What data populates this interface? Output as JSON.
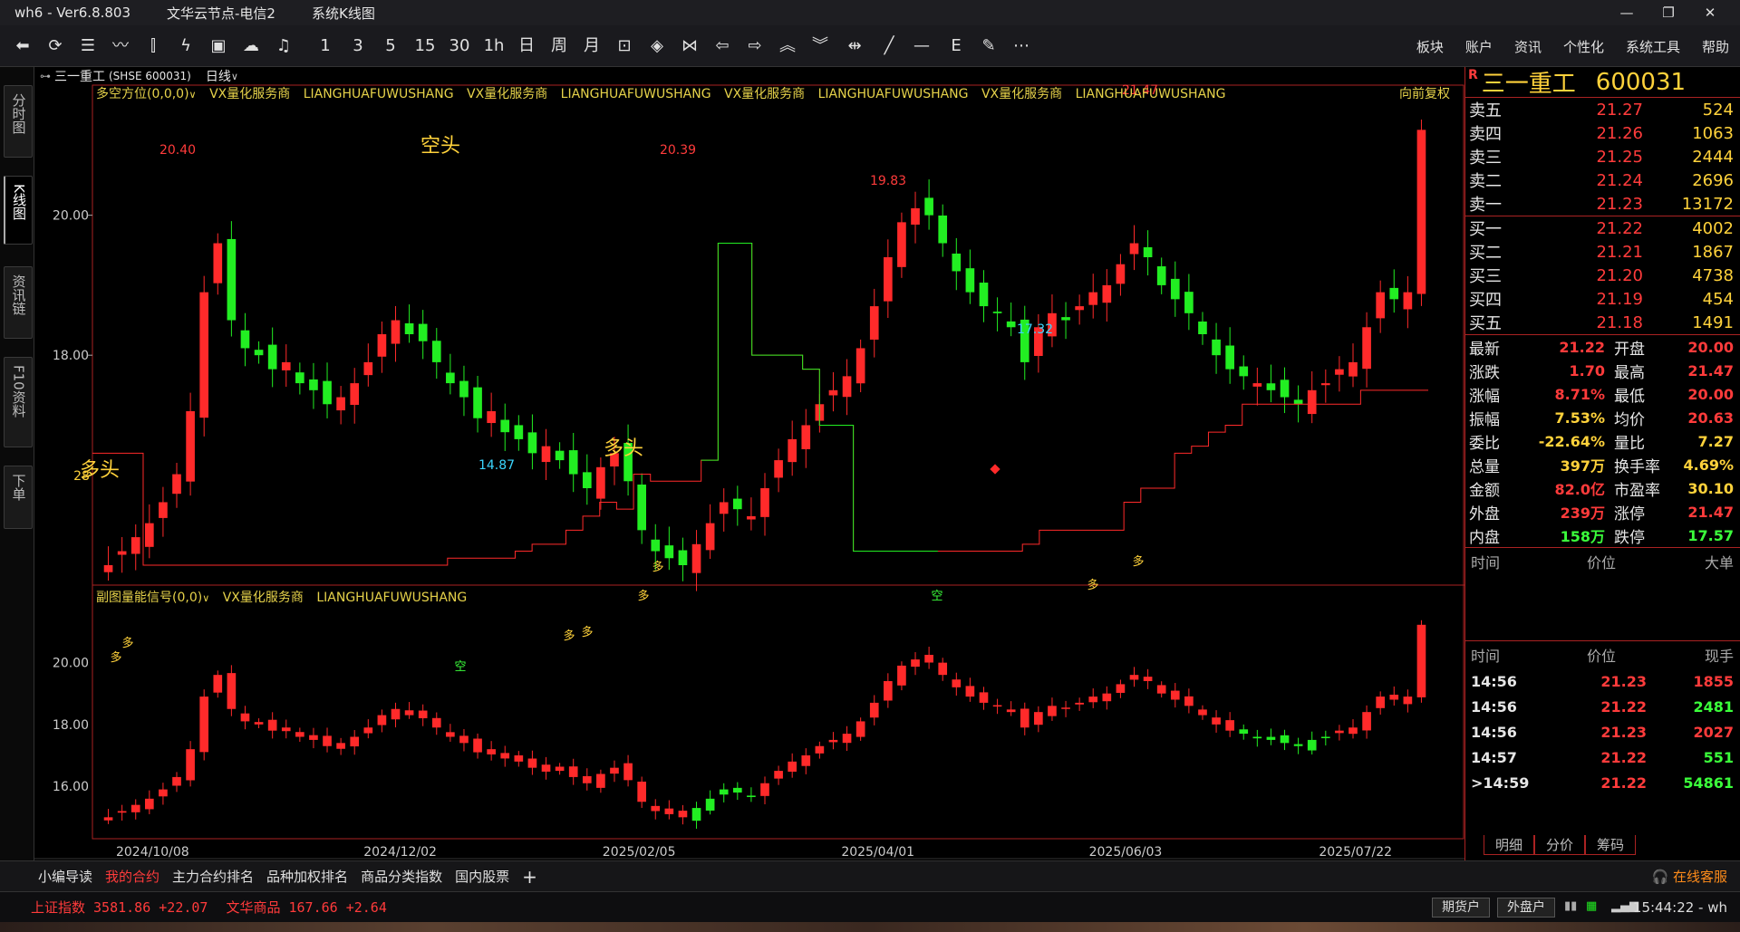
{
  "window": {
    "app": "wh6 - Ver6.8.803",
    "node": "文华云节点-电信2",
    "view": "系统K线图",
    "controls": [
      "—",
      "❐",
      "✕"
    ]
  },
  "toolbar": {
    "icons": [
      "back-icon",
      "refresh-icon",
      "table-icon",
      "line-chart-icon",
      "candle-icon",
      "lightning-icon",
      "grid-icon",
      "cloud-sync-icon",
      "bell-icon"
    ],
    "periods": [
      "1",
      "3",
      "5",
      "15",
      "30",
      "1h",
      "日",
      "周",
      "月"
    ],
    "menus": [
      "板块",
      "账户",
      "资讯",
      "个性化",
      "系统工具",
      "帮助"
    ]
  },
  "left_tabs": [
    "分时图",
    "K线图",
    "资讯链",
    "F10资料",
    "下单"
  ],
  "chart": {
    "symbol_name": "三一重工",
    "symbol_code": "(SHSE 600031)",
    "cycle": "日线",
    "indicator_main": "多空方位(0,0,0)",
    "indicator_sub": "副图量能信号(0,0)",
    "promo": "VX量化服务商",
    "promo_py": "LIANGHUAFUWUSHANG",
    "restore": "向前复权",
    "y_main": [
      "20.00",
      "18.00"
    ],
    "y_sub": [
      "20.00",
      "18.00",
      "16.00"
    ],
    "x_labels": [
      "2024/10/08",
      "2024/12/02",
      "2025/02/05",
      "2025/04/01",
      "2025/06/03",
      "2025/07/22"
    ],
    "labels": {
      "high1": "20.40",
      "high2": "20.39",
      "high3": "19.83",
      "high4": "21.47",
      "low1": "14.87",
      "low2": "17.32",
      "corner": "28"
    },
    "annotations": {
      "bear": "空头",
      "bull": "多头",
      "bull_left": "多头",
      "sig_bull": "多",
      "sig_bear": "空"
    }
  },
  "chart_data": {
    "type": "candlestick",
    "title": "",
    "xlabel": "",
    "ylabel": "",
    "x_ticks": [
      "2024/10/08",
      "2024/12/02",
      "2025/02/05",
      "2025/04/01",
      "2025/06/03",
      "2025/07/22"
    ],
    "ylim_main": [
      15.0,
      21.6
    ],
    "close": [
      15.0,
      15.2,
      15.4,
      15.6,
      15.9,
      16.3,
      17.2,
      18.9,
      19.6,
      18.5,
      18.1,
      18.0,
      17.8,
      17.9,
      17.6,
      17.5,
      17.3,
      17.4,
      17.6,
      17.9,
      18.3,
      18.5,
      18.3,
      18.2,
      17.9,
      17.6,
      17.4,
      17.1,
      17.2,
      16.9,
      16.8,
      16.6,
      16.7,
      16.5,
      16.3,
      16.1,
      16.4,
      16.6,
      16.2,
      15.5,
      15.2,
      15.1,
      15.0,
      15.3,
      15.6,
      15.9,
      15.8,
      15.7,
      16.1,
      16.5,
      16.8,
      17.0,
      17.3,
      17.5,
      17.7,
      18.1,
      18.7,
      19.4,
      19.9,
      20.1,
      20.0,
      19.6,
      19.2,
      18.9,
      18.7,
      18.6,
      18.4,
      17.9,
      18.4,
      18.6,
      18.5,
      18.7,
      18.9,
      19.0,
      19.3,
      19.6,
      19.4,
      19.0,
      18.8,
      18.6,
      18.3,
      18.0,
      17.8,
      17.7,
      17.6,
      17.5,
      17.4,
      17.3,
      17.5,
      17.6,
      17.8,
      17.9,
      18.4,
      18.9,
      18.8,
      18.9,
      21.22
    ],
    "signal_line": [
      16.6,
      16.6,
      16.6,
      15.0,
      15.0,
      15.0,
      15.0,
      15.0,
      15.0,
      15.0,
      15.0,
      15.0,
      15.0,
      15.0,
      15.0,
      15.0,
      15.0,
      15.0,
      15.0,
      15.0,
      15.0,
      15.1,
      15.1,
      15.1,
      15.1,
      15.2,
      15.3,
      15.3,
      15.5,
      15.7,
      15.9,
      15.8,
      16.3,
      16.2,
      16.2,
      16.2,
      16.5,
      19.6,
      19.6,
      18.0,
      18.0,
      18.0,
      17.8,
      17.0,
      17.0,
      15.2,
      15.2,
      15.2,
      15.2,
      15.2,
      15.2,
      15.2,
      15.2,
      15.2,
      15.2,
      15.3,
      15.5,
      15.5,
      15.5,
      15.5,
      15.5,
      15.9,
      16.1,
      16.1,
      16.6,
      16.7,
      16.9,
      17.0,
      17.3,
      17.3,
      17.3,
      17.3,
      17.3,
      17.3,
      17.3,
      17.5,
      17.5,
      17.5,
      17.5
    ],
    "signals": [
      {
        "label": "多"
      },
      {
        "label": "多"
      },
      {
        "label": "空"
      },
      {
        "label": "多"
      },
      {
        "label": "多"
      },
      {
        "label": "多"
      },
      {
        "label": "多"
      },
      {
        "label": "空"
      },
      {
        "label": "多"
      },
      {
        "label": "多"
      }
    ]
  },
  "quote": {
    "flag": "R",
    "name": "三一重工",
    "code": "600031",
    "asks": [
      {
        "label": "卖五",
        "price": "21.27",
        "vol": "524"
      },
      {
        "label": "卖四",
        "price": "21.26",
        "vol": "1063"
      },
      {
        "label": "卖三",
        "price": "21.25",
        "vol": "2444"
      },
      {
        "label": "卖二",
        "price": "21.24",
        "vol": "2696"
      },
      {
        "label": "卖一",
        "price": "21.23",
        "vol": "13172"
      }
    ],
    "bids": [
      {
        "label": "买一",
        "price": "21.22",
        "vol": "4002"
      },
      {
        "label": "买二",
        "price": "21.21",
        "vol": "1867"
      },
      {
        "label": "买三",
        "price": "21.20",
        "vol": "4738"
      },
      {
        "label": "买四",
        "price": "21.19",
        "vol": "454"
      },
      {
        "label": "买五",
        "price": "21.18",
        "vol": "1491"
      }
    ],
    "stats": [
      {
        "l1": "最新",
        "v1": "21.22",
        "l2": "开盘",
        "v2": "20.00",
        "c1": "#ff3b3b",
        "c2": "#ff3b3b"
      },
      {
        "l1": "涨跌",
        "v1": "1.70",
        "l2": "最高",
        "v2": "21.47",
        "c1": "#ff3b3b",
        "c2": "#ff3b3b"
      },
      {
        "l1": "涨幅",
        "v1": "8.71%",
        "l2": "最低",
        "v2": "20.00",
        "c1": "#ff3b3b",
        "c2": "#ff3b3b"
      },
      {
        "l1": "振幅",
        "v1": "7.53%",
        "l2": "均价",
        "v2": "20.63",
        "c1": "#ffd23b",
        "c2": "#ff3b3b"
      },
      {
        "l1": "委比",
        "v1": "-22.64%",
        "l2": "量比",
        "v2": "7.27",
        "c1": "#ffd23b",
        "c2": "#ffd23b"
      },
      {
        "l1": "总量",
        "v1": "397万",
        "l2": "换手率",
        "v2": "4.69%",
        "c1": "#ffd23b",
        "c2": "#ffd23b"
      },
      {
        "l1": "金额",
        "v1": "82.0亿",
        "l2": "市盈率",
        "v2": "30.10",
        "c1": "#ff3b3b",
        "c2": "#ffd23b"
      },
      {
        "l1": "外盘",
        "v1": "239万",
        "l2": "涨停",
        "v2": "21.47",
        "c1": "#ff3b3b",
        "c2": "#ff3b3b"
      },
      {
        "l1": "内盘",
        "v1": "158万",
        "l2": "跌停",
        "v2": "17.57",
        "c1": "#3bff3b",
        "c2": "#3bff3b"
      }
    ],
    "list_head": [
      "时间",
      "价位",
      "大单"
    ],
    "trade_head": [
      "时间",
      "价位",
      "现手"
    ],
    "trades": [
      {
        "t": "14:56",
        "p": "21.23",
        "v": "1855",
        "c": "#ff3b3b"
      },
      {
        "t": "14:56",
        "p": "21.22",
        "v": "2481",
        "c": "#3bff3b"
      },
      {
        "t": "14:56",
        "p": "21.23",
        "v": "2027",
        "c": "#ff3b3b"
      },
      {
        "t": "14:57",
        "p": "21.22",
        "v": "551",
        "c": "#3bff3b"
      },
      {
        "t": ">14:59",
        "p": "21.22",
        "v": "54861",
        "c": "#3bff3b"
      }
    ],
    "tabs": [
      "明细",
      "分价",
      "筹码"
    ]
  },
  "bottom_tabs": [
    "小编导读",
    "我的合约",
    "主力合约排名",
    "品种加权排名",
    "商品分类指数",
    "国内股票"
  ],
  "bottom_active": 1,
  "service": "在线客服",
  "status": {
    "idx1": "上证指数 3581.86 +22.07",
    "idx2": "文华商品 167.66 +2.64",
    "btn1": "期货户",
    "btn2": "外盘户",
    "clock": "15:44:22 - wh"
  },
  "colors": {
    "up": "#ff2a2a",
    "down": "#22ee22",
    "accent": "#ffd23b",
    "frame": "#aa2222"
  }
}
